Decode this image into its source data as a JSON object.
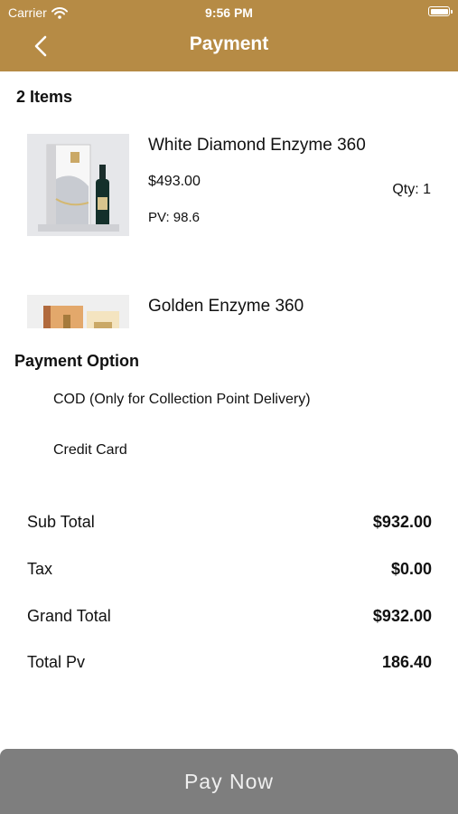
{
  "status_bar": {
    "carrier": "Carrier",
    "time": "9:56 PM"
  },
  "header": {
    "title": "Payment",
    "back_icon": "chevron-left-icon"
  },
  "cart": {
    "count_label": "2 Items",
    "items": [
      {
        "name": "White Diamond Enzyme 360",
        "price": "$493.00",
        "pv": "PV: 98.6",
        "qty": "Qty: 1"
      },
      {
        "name": "Golden Enzyme 360"
      }
    ]
  },
  "payment": {
    "title": "Payment Option",
    "options": [
      "COD (Only for Collection Point Delivery)",
      "Credit Card"
    ]
  },
  "totals": {
    "subtotal_label": "Sub Total",
    "subtotal_value": "$932.00",
    "tax_label": "Tax",
    "tax_value": "$0.00",
    "grand_label": "Grand Total",
    "grand_value": "$932.00",
    "pv_label": "Total Pv",
    "pv_value": "186.40"
  },
  "pay_button": {
    "label": "Pay Now"
  },
  "colors": {
    "header": "#b68b45",
    "button": "#7e7e7e"
  }
}
